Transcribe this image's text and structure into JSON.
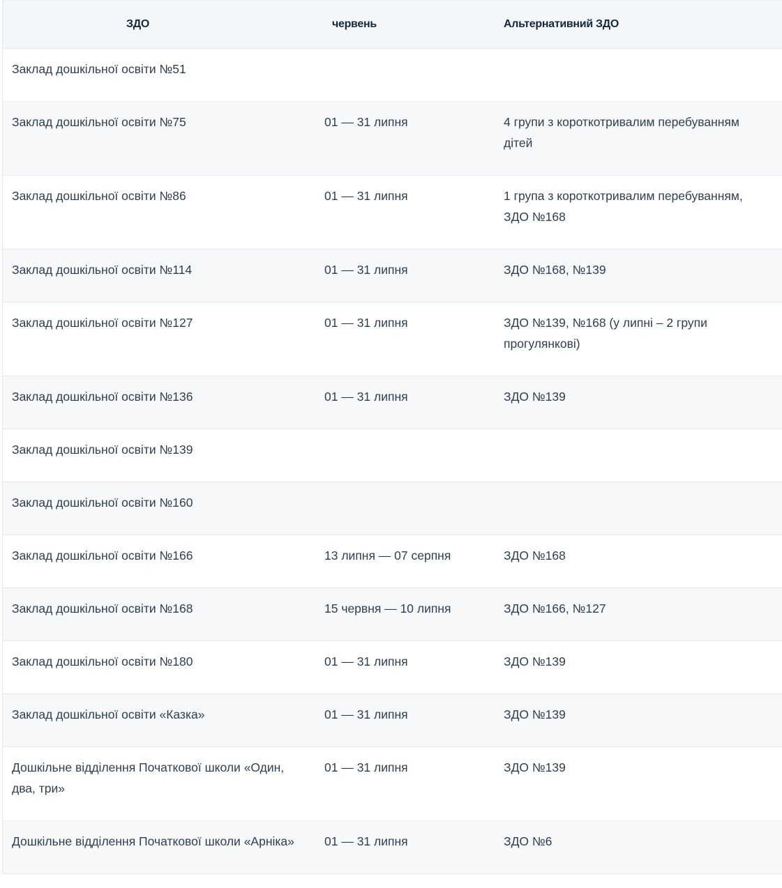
{
  "table": {
    "headers": [
      "ЗДО",
      "червень",
      "Альтернативний ЗДО"
    ],
    "rows": [
      {
        "name": "Заклад дошкільної освіти №51",
        "period": "",
        "alternative": ""
      },
      {
        "name": "Заклад дошкільної освіти №75",
        "period": "01 — 31 липня",
        "alternative": "4 групи з короткотривалим перебуванням дітей"
      },
      {
        "name": "Заклад дошкільної освіти №86",
        "period": "01 — 31 липня",
        "alternative": "1 група з короткотривалим перебуванням, ЗДО №168"
      },
      {
        "name": "Заклад дошкільної освіти №114",
        "period": "01 — 31 липня",
        "alternative": "ЗДО №168, №139"
      },
      {
        "name": "Заклад дошкільної освіти №127",
        "period": "01 — 31 липня",
        "alternative": "ЗДО №139, №168  (у липні – 2 групи прогулянкові)"
      },
      {
        "name": "Заклад дошкільної освіти №136",
        "period": "01 — 31 липня",
        "alternative": "ЗДО №139"
      },
      {
        "name": "Заклад дошкільної освіти №139",
        "period": "",
        "alternative": ""
      },
      {
        "name": "Заклад дошкільної освіти №160",
        "period": "",
        "alternative": ""
      },
      {
        "name": "Заклад дошкільної освіти №166",
        "period": "13 липня — 07 серпня",
        "alternative": "ЗДО №168"
      },
      {
        "name": "Заклад дошкільної освіти №168",
        "period": "15 червня — 10 липня",
        "alternative": "ЗДО №166, №127"
      },
      {
        "name": "Заклад дошкільної освіти №180",
        "period": "01 — 31 липня",
        "alternative": "ЗДО №139"
      },
      {
        "name": "Заклад дошкільної освіти «Казка»",
        "period": "01 — 31 липня",
        "alternative": "ЗДО №139"
      },
      {
        "name": "Дошкільне відділення Початкової школи «Один, два, три»",
        "period": "01 — 31 липня",
        "alternative": "ЗДО №139"
      },
      {
        "name": "Дошкільне відділення Початкової школи «Арніка»",
        "period": "01 — 31 липня",
        "alternative": "ЗДО №6"
      }
    ]
  }
}
